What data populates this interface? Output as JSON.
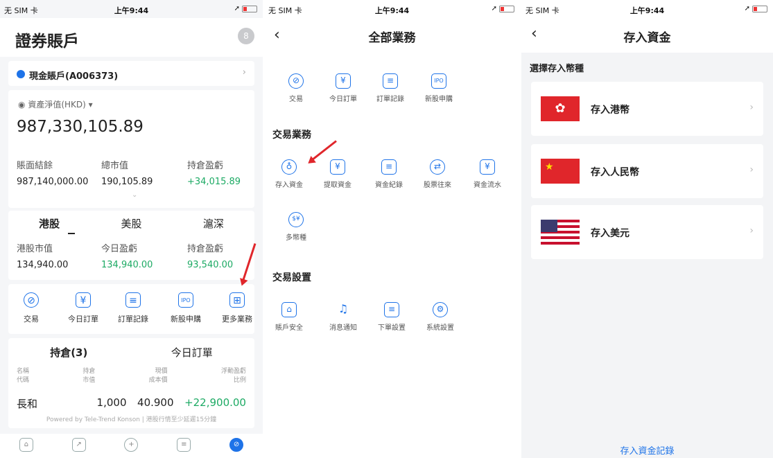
{
  "status": {
    "carrier": "无 SIM 卡",
    "time": "上午9:44"
  },
  "p1": {
    "title": "證券賬戶",
    "avatar": "8",
    "account": "現金賬戶(A006373)",
    "net_label": "資產淨值(HKD)",
    "net_value": "987,330,105.89",
    "kv": [
      {
        "k": "賬面結餘",
        "v": "987,140,000.00"
      },
      {
        "k": "總市值",
        "v": "190,105.89"
      },
      {
        "k": "持倉盈虧",
        "v": "+34,015.89"
      }
    ],
    "market_tabs": [
      "港股",
      "美股",
      "滬深"
    ],
    "market_kv": [
      {
        "k": "港股市值",
        "v": "134,940.00"
      },
      {
        "k": "今日盈虧",
        "v": "134,940.00"
      },
      {
        "k": "持倉盈虧",
        "v": "93,540.00"
      }
    ],
    "tools": [
      "交易",
      "今日訂單",
      "訂單記錄",
      "新股申購",
      "更多業務"
    ],
    "hold_tabs": [
      "持倉(3)",
      "今日訂單"
    ],
    "hold_headers": [
      "名稱",
      "代碼",
      "持倉",
      "市值",
      "現價",
      "成本價",
      "浮動盈虧",
      "比例"
    ],
    "hold_row": {
      "name": "長和",
      "qty": "1,000",
      "price": "40.900",
      "pnl": "+22,900.00"
    },
    "powered": "Powered by Tele-Trend Konson | 港股行情至少延遲15分鐘"
  },
  "p2": {
    "title": "全部業務",
    "top_items": [
      "交易",
      "今日訂單",
      "訂單記錄",
      "新股申購"
    ],
    "sect1": "交易業務",
    "trade_items": [
      "存入資金",
      "提取資金",
      "資金紀錄",
      "股票往來",
      "資金流水",
      "多幣種"
    ],
    "sect2": "交易設置",
    "setting_items": [
      "賬戶安全",
      "消息通知",
      "下單設置",
      "系統設置"
    ]
  },
  "p3": {
    "title": "存入資金",
    "subtitle": "選擇存入幣種",
    "currencies": [
      "存入港幣",
      "存入人民幣",
      "存入美元"
    ],
    "link": "存入資金記錄"
  }
}
